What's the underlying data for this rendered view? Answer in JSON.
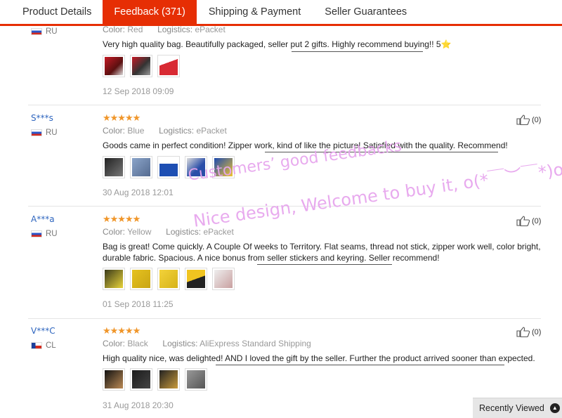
{
  "tabs": [
    {
      "label": "Product Details"
    },
    {
      "label": "Feedback (371)"
    },
    {
      "label": "Shipping & Payment"
    },
    {
      "label": "Seller Guarantees"
    }
  ],
  "labels": {
    "color": "Color:",
    "logistics": "Logistics:"
  },
  "reviews": [
    {
      "country": "RU",
      "color": "Red",
      "logistics": "ePacket",
      "text": "Very high quality bag. Beautifully packaged, seller put 2 gifts. Highly recommend buying!! 5⭐",
      "date": "12 Sep 2018 09:09"
    },
    {
      "user": "S***s",
      "country": "RU",
      "stars": "★★★★★",
      "color": "Blue",
      "logistics": "ePacket",
      "text": "Goods came in perfect condition! Zipper work, kind of like the picture! Satisfied with the quality. Recommend!",
      "date": "30 Aug 2018 12:01",
      "likes": "(0)"
    },
    {
      "user": "A***a",
      "country": "RU",
      "stars": "★★★★★",
      "color": "Yellow",
      "logistics": "ePacket",
      "text": "Bag is great! Come quickly. A Couple Of weeks to Territory. Flat seams, thread not stick, zipper work well, color bright, durable fabric. Spacious. A nice bonus from seller stickers and keyring. Seller recommend!",
      "date": "01 Sep 2018 11:25",
      "likes": "(0)"
    },
    {
      "user": "V***C",
      "country": "CL",
      "stars": "★★★★★",
      "color": "Black",
      "logistics": "AliExpress Standard Shipping",
      "text": "High quality nice, was delighted! AND I loved the gift by the seller. Further the product arrived sooner than expected.",
      "date": "31 Aug 2018 20:30",
      "likes": "(0)"
    }
  ],
  "overlay": {
    "line1": "Customers’ good feedbacks",
    "line2": "Nice design, Welcome to buy it, o(*￣︶￣*)o"
  },
  "recently_viewed": "Recently Viewed",
  "colors": {
    "accent": "#e62e04",
    "star": "#f0962a",
    "link": "#2f66bf",
    "overlay": "#e7a6ee"
  }
}
